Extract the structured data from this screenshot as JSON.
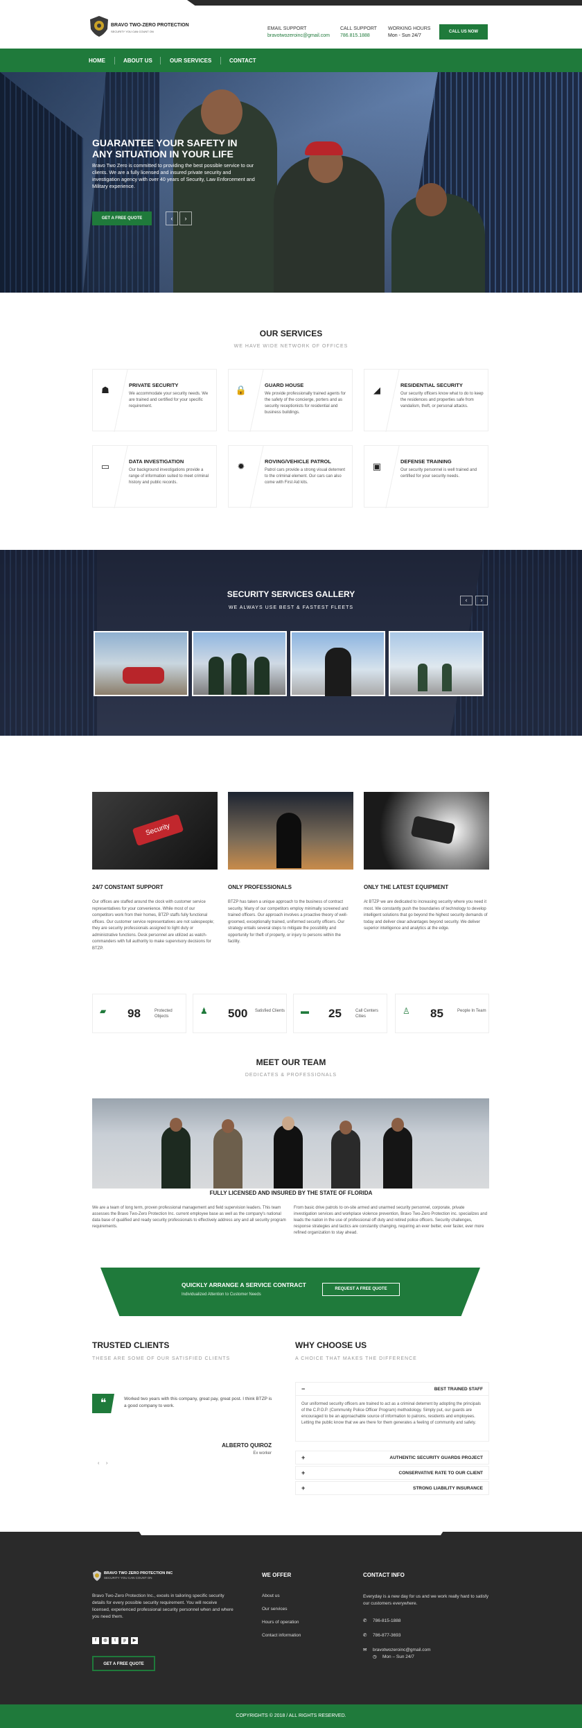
{
  "header": {
    "logo_title": "BRAVO TWO-ZERO PROTECTION",
    "logo_sub": "SECURITY YOU CAN COUNT ON",
    "email_label": "EMAIL SUPPORT",
    "email_value": "bravotwozeroinc@gmail.com",
    "call_label": "CALL SUPPORT",
    "call_value": "786.815.1888",
    "hours_label": "WORKING HOURS",
    "hours_value": "Mon - Sun 24/7",
    "call_now": "CALL US NOW"
  },
  "nav": [
    "HOME",
    "ABOUT US",
    "OUR SERVICES",
    "CONTACT"
  ],
  "hero": {
    "title": "GUARANTEE YOUR SAFETY IN ANY SITUATION IN YOUR LIFE",
    "text": "Bravo Two Zero is committed to providing the best possible service to our clients. We are a fully licensed and insured private security and investigation agency with over 40 years of Security, Law Enforcement and Military experience.",
    "button": "GET A FREE QUOTE"
  },
  "services": {
    "title": "OUR SERVICES",
    "subtitle": "WE HAVE WIDE NETWORK OF OFFICES",
    "items": [
      {
        "icon": "person-icon",
        "glyph": "☗",
        "title": "PRIVATE SECURITY",
        "text": "We accommodate your security needs. We are trained and certified for your specific requirement."
      },
      {
        "icon": "lock-icon",
        "glyph": "🔒",
        "title": "GUARD HOUSE",
        "text": "We provide professionally trained agents for the safety of the concierge, porters and as security receptionists for residential and business buildings."
      },
      {
        "icon": "camera-icon",
        "glyph": "◢",
        "title": "RESIDENTIAL SECURITY",
        "text": "Our security officers know what to do to keep the residences and properties safe from vandalism, theft, or personal attacks."
      },
      {
        "icon": "monitor-icon",
        "glyph": "▭",
        "title": "DATA INVESTIGATION",
        "text": "Our background investigations provide a range of information suited to meet criminal history and public records."
      },
      {
        "icon": "siren-icon",
        "glyph": "✹",
        "title": "ROVING/VEHICLE PATROL",
        "text": "Patrol cars provide a strong visual deterrent to the criminal element. Our cars can also come with First Aid kits."
      },
      {
        "icon": "briefcase-icon",
        "glyph": "▣",
        "title": "DEFENSE TRAINING",
        "text": "Our security personnel is well trained and certified for your security needs."
      }
    ]
  },
  "gallery": {
    "title": "SECURITY SERVICES GALLERY",
    "subtitle": "WE ALWAYS USE BEST & FASTEST FLEETS"
  },
  "features": [
    {
      "title": "24/7 CONSTANT SUPPORT",
      "text": "Our offices are staffed around the clock with customer service representatives for your convenience. While most of our competitors work from their homes, BTZP staffs fully functional offices. Our customer service representatives are not salespeople; they are security professionals assigned to light duty or administrative functions. Desk personnel are utilized as watch-commanders with full authority to make supervisory decisions for BTZP."
    },
    {
      "title": "ONLY PROFESSIONALS",
      "text": "BTZP has taken a unique approach to the business of contract security. Many of our competitors employ minimally screened and trained officers. Our approach involves a proactive theory of well-groomed, exceptionally trained, uniformed security officers. Our strategy entails several steps to mitigate the possibility and opportunity for theft of property, or injury to persons within the facility."
    },
    {
      "title": "ONLY THE LATEST EQUIPMENT",
      "text": "At BTZP we are dedicated to increasing security where you need it most. We constantly push the boundaries of technology to develop intelligent solutions that go beyond the highest security demands of today and deliver clear advantages beyond security. We deliver superior intelligence and analytics at the edge."
    }
  ],
  "stats": [
    {
      "icon": "folder-icon",
      "glyph": "▰",
      "number": "98",
      "label": "Protected Objects"
    },
    {
      "icon": "users-icon",
      "glyph": "♟",
      "number": "500",
      "label": "Satisfied Clients"
    },
    {
      "icon": "truck-icon",
      "glyph": "▬",
      "number": "25",
      "label": "Call Centers Cities"
    },
    {
      "icon": "person-icon",
      "glyph": "♙",
      "number": "85",
      "label": "People In Team"
    }
  ],
  "team": {
    "title": "MEET OUR TEAM",
    "subtitle": "DEDICATES & PROFESSIONALS",
    "caption": "FULLY LICENSED AND INSURED BY THE STATE OF FLORIDA",
    "text_left": "We are a team of long term, proven professional management and field supervision leaders. This team assesses the Bravo Two-Zero Protection Inc. current employee base as well as the company's national data base of qualified and ready security professionals to effectively address any and all security program requirements.",
    "text_right": "From basic drive patrols to on-site armed and unarmed security personnel, corporate, private investigation services and workplace violence prevention, Bravo Two-Zero Protection inc. specializes and leads the nation in the use of professional off duty and retired police officers. Security challenges, response strategies and tactics are constantly changing, requiring an ever better, ever faster, ever more refined organization to stay ahead."
  },
  "cta": {
    "title": "QUICKLY ARRANGE A SERVICE CONTRACT",
    "subtitle": "Individualized Attention to Customer Needs",
    "button": "REQUEST A FREE QUOTE"
  },
  "clients": {
    "title": "TRUSTED CLIENTS",
    "subtitle": "THESE ARE SOME OF OUR SATISFIED CLIENTS",
    "quote": "Worked two years with this company, great pay, great post. I think BTZP is a good company to work.",
    "name": "ALBERTO QUIROZ",
    "role": "Ex worker"
  },
  "why": {
    "title": "WHY CHOOSE US",
    "subtitle": "A CHOICE THAT MAKES THE DIFFERENCE",
    "open_item": "BEST TRAINED STAFF",
    "open_text": "Our uniformed security officers are trained to act as a criminal deterrent by adopting the principals of the C.P.O.P. (Community Police Officer Program) methodology. Simply put, our guards are encouraged to be an approachable source of information to patrons, residents and employees. Letting the public know that we are there for them generates a feeling of community and safety.",
    "items": [
      "AUTHENTIC SECURITY GUARDS PROJECT",
      "CONSERVATIVE RATE TO OUR CLIENT",
      "STRONG LIABILITY INSURANCE"
    ]
  },
  "footer": {
    "logo_title": "BRAVO TWO ZERO PROTECTION INC",
    "logo_sub": "SECURITY YOU CAN COUNT ON",
    "about": "Bravo Two-Zero Protection Inc., excels in tailoring specific security details for every possible security requirement. You will receive licensed, experienced professional security personnel when and where you need them.",
    "button": "GET A FREE QUOTE",
    "offer_title": "WE OFFER",
    "offer_links": [
      "About us",
      "Our services",
      "Hours of operation",
      "Contact information"
    ],
    "contact_title": "CONTACT INFO",
    "contact_text": "Everyday is a new day for us and we work really hard to satisfy our customers everywhere.",
    "phone1": "786-815-1888",
    "phone2": "786-877-3693",
    "email": "bravotwozeroinc@gmail.com",
    "hours": "Mon – Sun 24/7",
    "copyright": "COPYRIGHTS © 2018 / ALL RIGHTS RESERVED."
  },
  "colors": {
    "brand_green": "#1f7a3b",
    "dark": "#2a2a2a"
  }
}
